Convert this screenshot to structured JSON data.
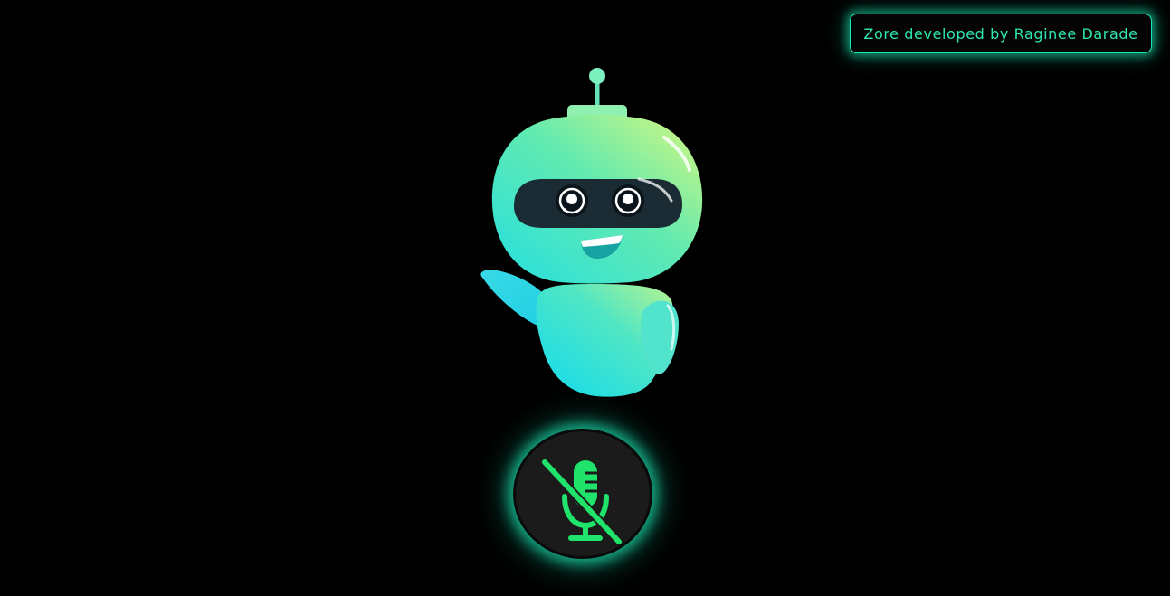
{
  "header": {
    "credit_text": "Zore developed by Raginee Darade"
  },
  "assistant": {
    "avatar_icon": "robot-mascot-icon"
  },
  "voice": {
    "mic_state": "muted",
    "mic_icon": "microphone-off-icon"
  },
  "colors": {
    "background": "#000000",
    "accent_glow": "#1de9b6",
    "mic_icon": "#1fe36a",
    "credit_text": "#2ee8b0"
  }
}
